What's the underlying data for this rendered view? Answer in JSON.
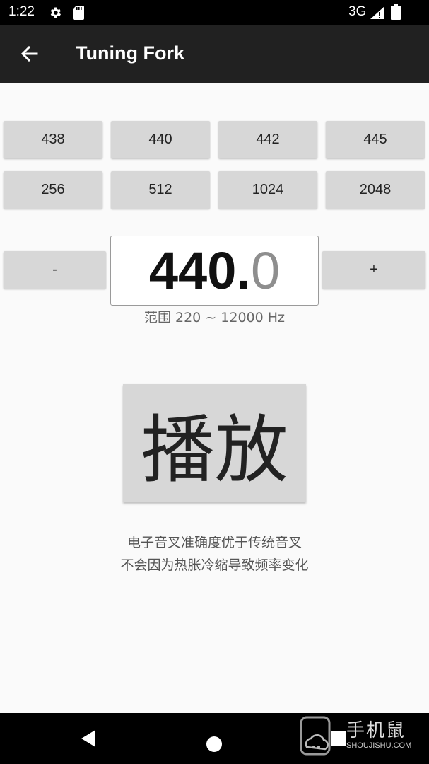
{
  "status_bar": {
    "time": "1:22",
    "network": "3G",
    "icons": [
      "gear-icon",
      "sd-card-icon",
      "signal-icon",
      "battery-icon"
    ]
  },
  "app_bar": {
    "title": "Tuning Fork",
    "back_icon": "arrow-back-icon"
  },
  "presets": {
    "row1": [
      "438",
      "440",
      "442",
      "445"
    ],
    "row2": [
      "256",
      "512",
      "1024",
      "2048"
    ]
  },
  "stepper": {
    "minus_label": "-",
    "plus_label": "+",
    "value_int": "440.",
    "value_dec": "0"
  },
  "range_text": "范围 220 ~ 12000 Hz",
  "play_label": "播放",
  "description": {
    "line1": "电子音叉准确度优于传统音叉",
    "line2": "不会因为热胀冷缩导致频率变化"
  },
  "watermark": {
    "title": "手机鼠",
    "subtitle": "SHOUJISHU.COM"
  },
  "nav_bar": {
    "icons": [
      "nav-back-icon",
      "nav-home-icon",
      "nav-recents-icon"
    ]
  },
  "colors": {
    "app_bar": "#212121",
    "button": "#d7d7d7",
    "background": "#fafafa"
  }
}
